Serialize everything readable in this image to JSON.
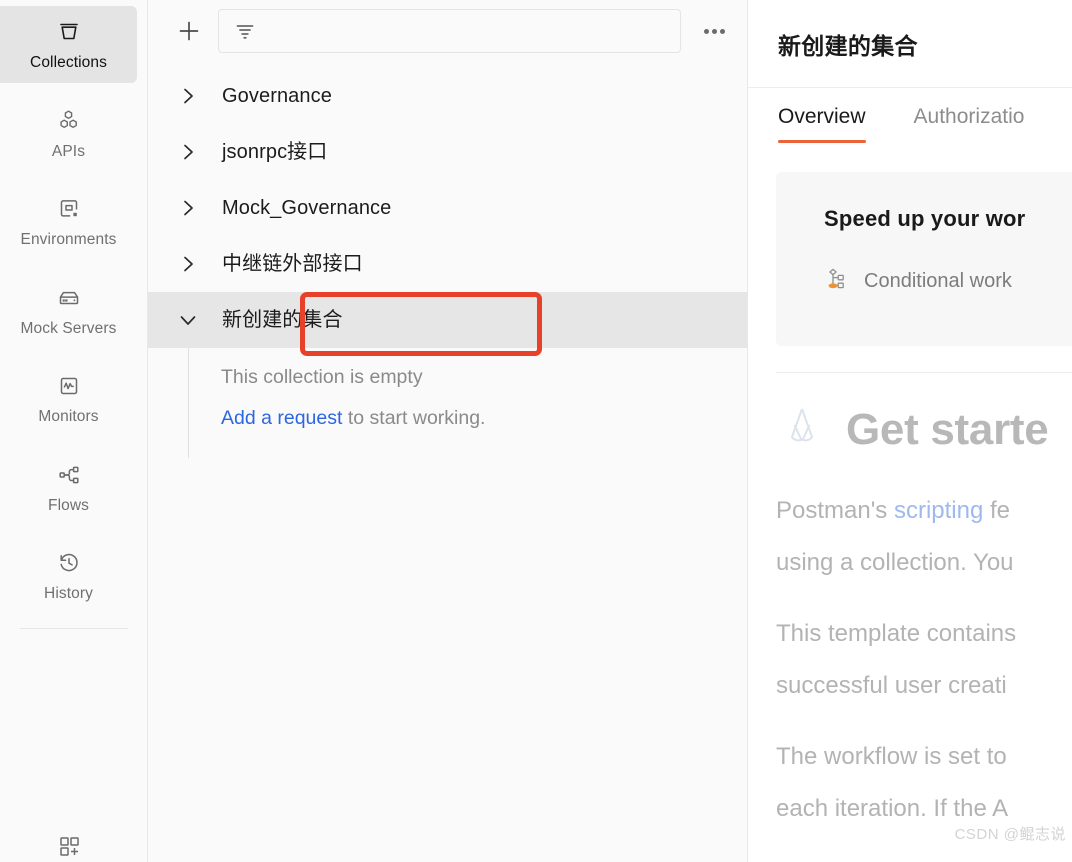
{
  "rail": {
    "items": [
      {
        "label": "Collections",
        "icon": "collections-icon",
        "active": true
      },
      {
        "label": "APIs",
        "icon": "apis-icon",
        "active": false
      },
      {
        "label": "Environments",
        "icon": "environments-icon",
        "active": false
      },
      {
        "label": "Mock Servers",
        "icon": "mock-servers-icon",
        "active": false
      },
      {
        "label": "Monitors",
        "icon": "monitors-icon",
        "active": false
      },
      {
        "label": "Flows",
        "icon": "flows-icon",
        "active": false
      },
      {
        "label": "History",
        "icon": "history-icon",
        "active": false
      }
    ],
    "bottom_icon": "add-module-icon"
  },
  "sidebar": {
    "new_button_label": "+",
    "filter_placeholder": "",
    "filter_icon": "filter-icon",
    "more_actions_icon": "more-horizontal-icon",
    "collections": [
      {
        "name": "Governance",
        "expanded": false,
        "selected": false
      },
      {
        "name": "jsonrpc接口",
        "expanded": false,
        "selected": false
      },
      {
        "name": "Mock_Governance",
        "expanded": false,
        "selected": false
      },
      {
        "name": "中继链外部接口",
        "expanded": false,
        "selected": false
      },
      {
        "name": "新创建的集合",
        "expanded": true,
        "selected": true
      }
    ],
    "empty_state": {
      "line1": "This collection is empty",
      "link": "Add a request",
      "line2_rest": " to start working."
    },
    "highlight_color": "#e8412a"
  },
  "panel": {
    "title": "新创建的集合",
    "tabs": [
      {
        "label": "Overview",
        "active": true
      },
      {
        "label": "Authorizatio",
        "active": false
      }
    ],
    "accent_color": "#eb6438",
    "promo": {
      "title": "Speed up your wor",
      "item_icon": "conditional-workflow-icon",
      "item_label": "Conditional work"
    },
    "getting_started": {
      "logo_icon": "postman-logo-icon",
      "heading": "Get starte",
      "paragraphs": [
        {
          "before": "Postman's ",
          "link": "scripting",
          "after": " fe"
        },
        {
          "before": "using a collection. You",
          "link": "",
          "after": ""
        },
        {
          "before": "This template contains",
          "link": "",
          "after": ""
        },
        {
          "before": "successful user creati",
          "link": "",
          "after": ""
        },
        {
          "before": "The workflow is set to",
          "link": "",
          "after": ""
        },
        {
          "before": "each iteration. If the A",
          "link": "",
          "after": ""
        }
      ]
    }
  },
  "watermark": "CSDN @鲲志说"
}
